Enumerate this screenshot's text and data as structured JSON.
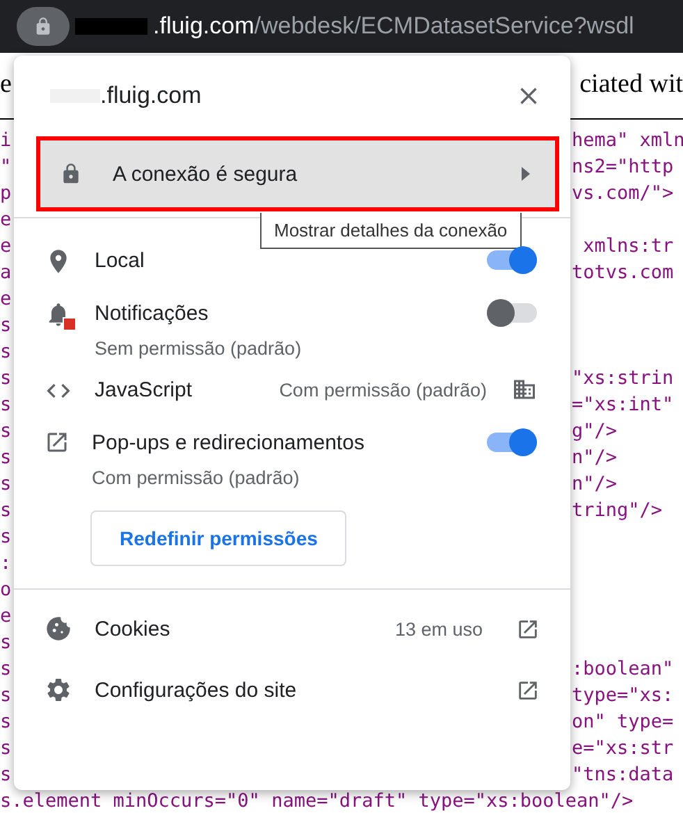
{
  "address_bar": {
    "host": ".fluig.com",
    "path": "/webdesk/ECMDatasetService?wsdl"
  },
  "page": {
    "heading_left": "e",
    "heading_right": "ciated wit",
    "code_lines": [
      {
        "left": "i",
        "right": "hema\" xmln"
      },
      {
        "left": "\"",
        "right": "ns2=\"http"
      },
      {
        "left": "p",
        "right": "vs.com/\">"
      },
      {
        "left": "e"
      },
      {
        "left": "e",
        "right": " xmlns:tr"
      },
      {
        "left": "a",
        "right": "totvs.com"
      },
      {
        "left": "e"
      },
      {
        "left": "s"
      },
      {
        "left": "s"
      },
      {
        "left": "s",
        "right": "\"xs:strin"
      },
      {
        "left": "s",
        "right": "=\"xs:int\""
      },
      {
        "left": "s",
        "right": "g\"/>"
      },
      {
        "left": "s",
        "right": "n\"/>"
      },
      {
        "left": "s",
        "right": "n\"/>"
      },
      {
        "left": "s",
        "right": "tring\"/>"
      },
      {
        "left": "s"
      },
      {
        "left": ":"
      },
      {
        "left": "o"
      },
      {
        "left": "e"
      },
      {
        "left": "s"
      },
      {
        "left": "s",
        "right": ":boolean\""
      },
      {
        "left": "s",
        "right": "type=\"xs:"
      },
      {
        "left": "s",
        "right": "on\" type="
      },
      {
        "left": "s",
        "right": "e=\"xs:str"
      },
      {
        "left": "s",
        "right": "\"tns:data"
      }
    ],
    "bottom_line": "s.element minOccurs=\"0\" name=\"draft\" type=\"xs:boolean\"/>"
  },
  "popup": {
    "title": ".fluig.com",
    "connection": {
      "label": "A conexão é segura",
      "highlighted": true
    },
    "tooltip": "Mostrar detalhes da conexão",
    "permissions": [
      {
        "kind": "toggle",
        "label": "Local",
        "on": true
      },
      {
        "kind": "toggle",
        "label": "Notificações",
        "sublabel": "Sem permissão (padrão)",
        "on": false
      },
      {
        "kind": "value",
        "label": "JavaScript",
        "value": "Com permissão (padrão)"
      },
      {
        "kind": "toggle",
        "label": "Pop-ups e redirecionamentos",
        "sublabel": "Com permissão (padrão)",
        "on": true
      }
    ],
    "reset_button": "Redefinir permissões",
    "links": [
      {
        "label": "Cookies",
        "value": "13 em uso"
      },
      {
        "label": "Configurações do site"
      }
    ]
  }
}
